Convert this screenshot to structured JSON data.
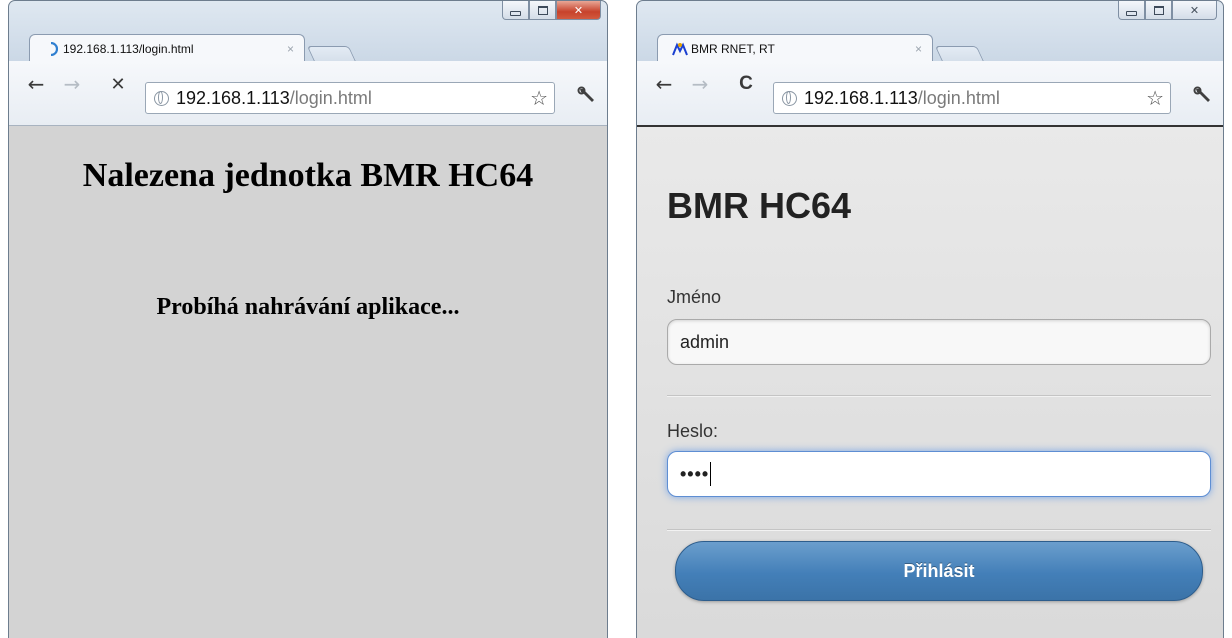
{
  "left_window": {
    "tab": {
      "title": "192.168.1.113/login.html",
      "close": "×",
      "icon": "loading-spinner-icon"
    },
    "toolbar": {
      "back": "←",
      "forward": "→",
      "stop": "✕",
      "url_host": "192.168.1.113",
      "url_path": "/login.html",
      "star": "☆",
      "wrench": "🔧"
    },
    "page": {
      "heading": "Nalezena jednotka BMR HC64",
      "subheading": "Probíhá nahrávání aplikace..."
    }
  },
  "right_window": {
    "tab": {
      "title": "BMR RNET, RT",
      "close": "×",
      "icon": "bmr-logo-icon"
    },
    "toolbar": {
      "back": "←",
      "forward": "→",
      "reload": "C",
      "url_host": "192.168.1.113",
      "url_path": "/login.html",
      "star": "☆",
      "wrench": "🔧"
    },
    "page": {
      "title": "BMR HC64",
      "username_label": "Jméno",
      "username_value": "admin",
      "password_label": "Heslo:",
      "password_value": "••••",
      "login_button": "Přihlásit"
    }
  },
  "colors": {
    "left_content_bg": "#d3d3d3",
    "login_button": "#437fb8",
    "close_button_active": "#c7422b"
  }
}
